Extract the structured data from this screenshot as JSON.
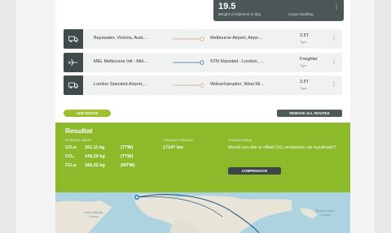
{
  "shipment": {
    "weight_value": "19.5",
    "weight_label": "Weight of shipment in (kg)",
    "cargo_label": "Cargo handling",
    "menu_glyph": "⋮"
  },
  "routes": [
    {
      "icon": "truck-icon",
      "from": "Bayswater, Victoria, Aust…",
      "to": "Melbourne Airport, Airpo…",
      "value": "3.5T",
      "type": "Type"
    },
    {
      "icon": "plane-icon",
      "from": "MEL Melbourne Intl - Mel…",
      "to": "STN Stansted - London, …",
      "value": "Freighter",
      "type": "Type"
    },
    {
      "icon": "truck-icon",
      "from": "London Stansted Airport,…",
      "to": "Wolverhampton, West Mi…",
      "value": "3.5T",
      "type": "Type"
    }
  ],
  "buttons": {
    "add_route": "ADD ROUTE",
    "remove_all": "REMOVE ALL ROUTES",
    "compensate": "COMPENSATE"
  },
  "result": {
    "title": "Resultat",
    "emission_label": "Emission values",
    "emissions": [
      {
        "gas": "CO₂e",
        "amount": "151.11 kg",
        "scope": "(TTW)"
      },
      {
        "gas": "CO₂",
        "amount": "149.29 kg",
        "scope": "(TTW)"
      },
      {
        "gas": "CO₂e",
        "amount": "185.52 kg",
        "scope": "(WTW)"
      }
    ],
    "transport_label": "Transport distance",
    "transport_value": "17147 km",
    "compensating_label": "Compensating",
    "compensating_question": "Would you like to offset CO₂ emissions via myclimate?"
  },
  "map": {
    "label_north_atlantic": "North Atlantic Ocean",
    "label_north_pacific": "North Pacific Ocean"
  },
  "colors": {
    "accent_green": "#8dba2b",
    "dark": "#3f4b4b"
  }
}
